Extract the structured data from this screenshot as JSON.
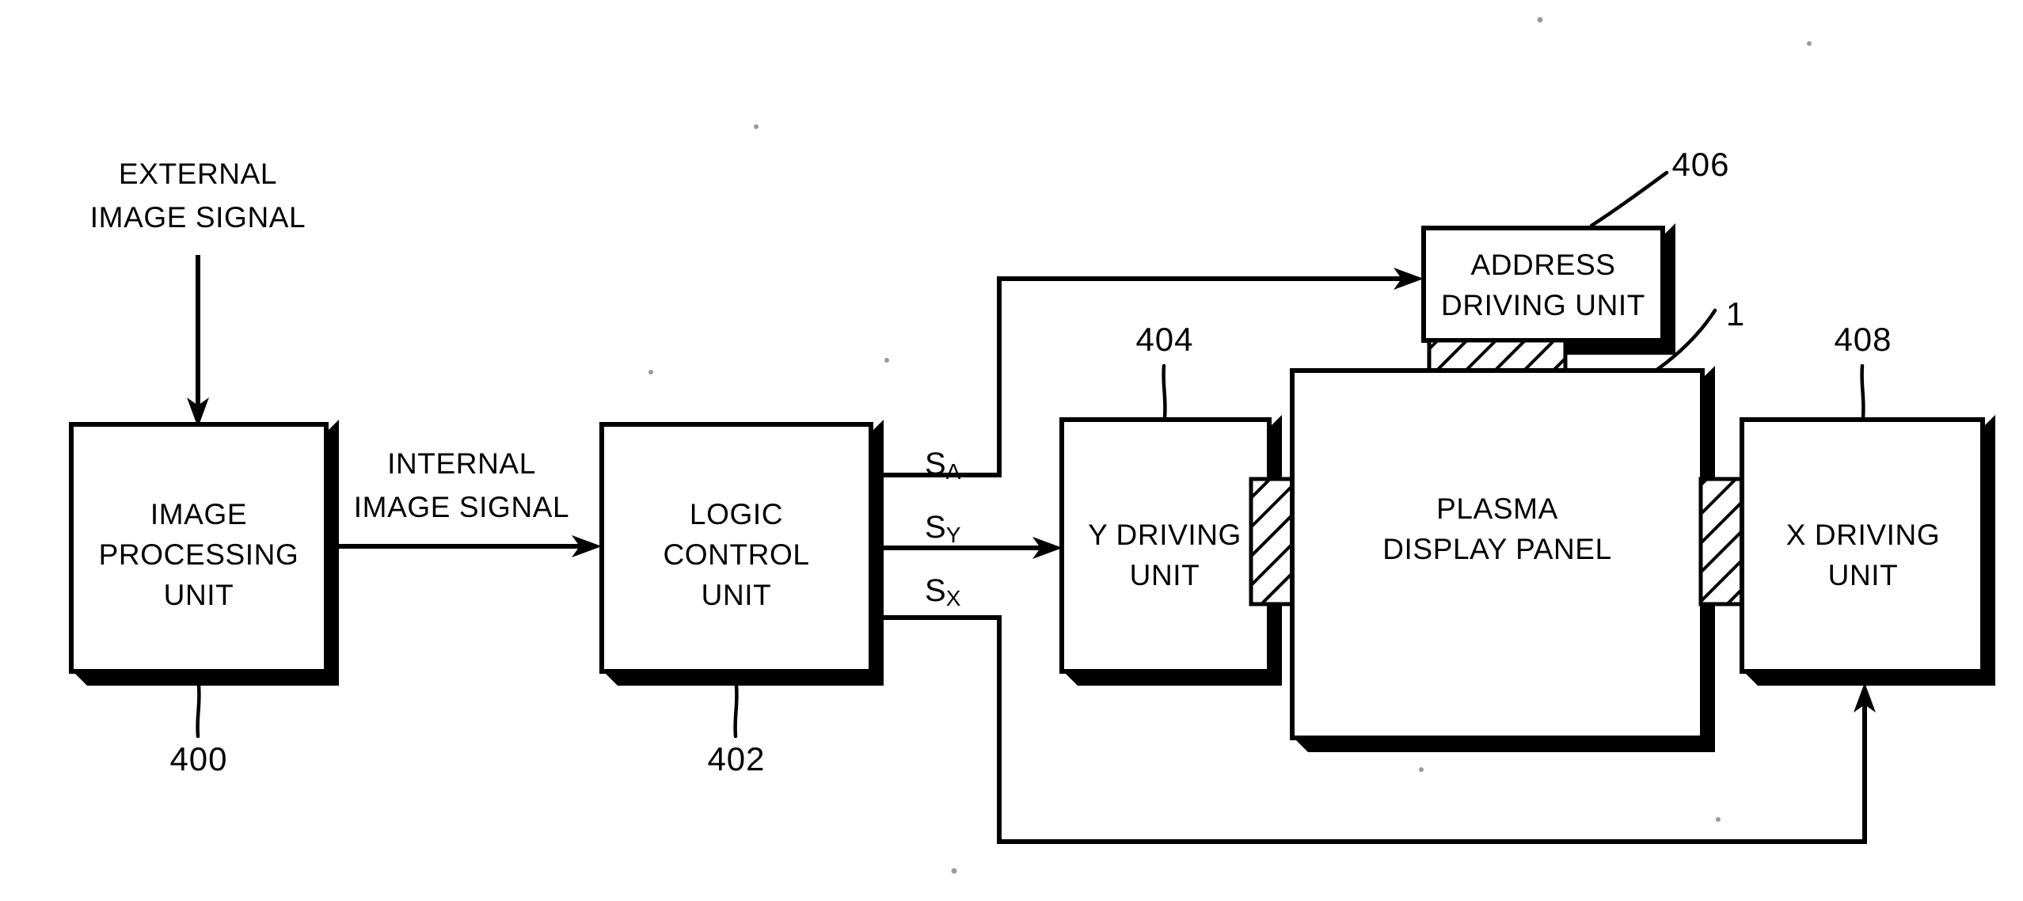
{
  "figure": {
    "type": "patent-block-diagram",
    "subject": "Plasma display panel driving apparatus"
  },
  "blocks": [
    {
      "id": "image-processing-unit",
      "lines": [
        "IMAGE",
        "PROCESSING",
        "UNIT"
      ],
      "ref": "400"
    },
    {
      "id": "logic-control-unit",
      "lines": [
        "LOGIC",
        "CONTROL",
        "UNIT"
      ],
      "ref": "402"
    },
    {
      "id": "y-driving-unit",
      "lines": [
        "Y DRIVING",
        "UNIT"
      ],
      "ref": "404"
    },
    {
      "id": "address-driving-unit",
      "lines": [
        "ADDRESS",
        "DRIVING UNIT"
      ],
      "ref": "406"
    },
    {
      "id": "plasma-display-panel",
      "lines": [
        "PLASMA",
        "DISPLAY PANEL"
      ],
      "ref": "1"
    },
    {
      "id": "x-driving-unit",
      "lines": [
        "X DRIVING",
        "UNIT"
      ],
      "ref": "408"
    }
  ],
  "block_text": {
    "image_processing_l1": "IMAGE",
    "image_processing_l2": "PROCESSING",
    "image_processing_l3": "UNIT",
    "logic_control_l1": "LOGIC",
    "logic_control_l2": "CONTROL",
    "logic_control_l3": "UNIT",
    "y_driving_l1": "Y DRIVING",
    "y_driving_l2": "UNIT",
    "address_driving_l1": "ADDRESS",
    "address_driving_l2": "DRIVING UNIT",
    "panel_l1": "PLASMA",
    "panel_l2": "DISPLAY PANEL",
    "x_driving_l1": "X DRIVING",
    "x_driving_l2": "UNIT"
  },
  "signal_labels": {
    "external_l1": "EXTERNAL",
    "external_l2": "IMAGE SIGNAL",
    "internal_l1": "INTERNAL",
    "internal_l2": "IMAGE SIGNAL",
    "s_a_base": "S",
    "s_a_sub": "A",
    "s_y_base": "S",
    "s_y_sub": "Y",
    "s_x_base": "S",
    "s_x_sub": "X"
  },
  "reference_numerals": {
    "image_processing": "400",
    "logic_control": "402",
    "y_driving": "404",
    "address_driving": "406",
    "panel": "1",
    "x_driving": "408"
  },
  "colors": {
    "ink": "#000000",
    "paper": "#ffffff"
  }
}
